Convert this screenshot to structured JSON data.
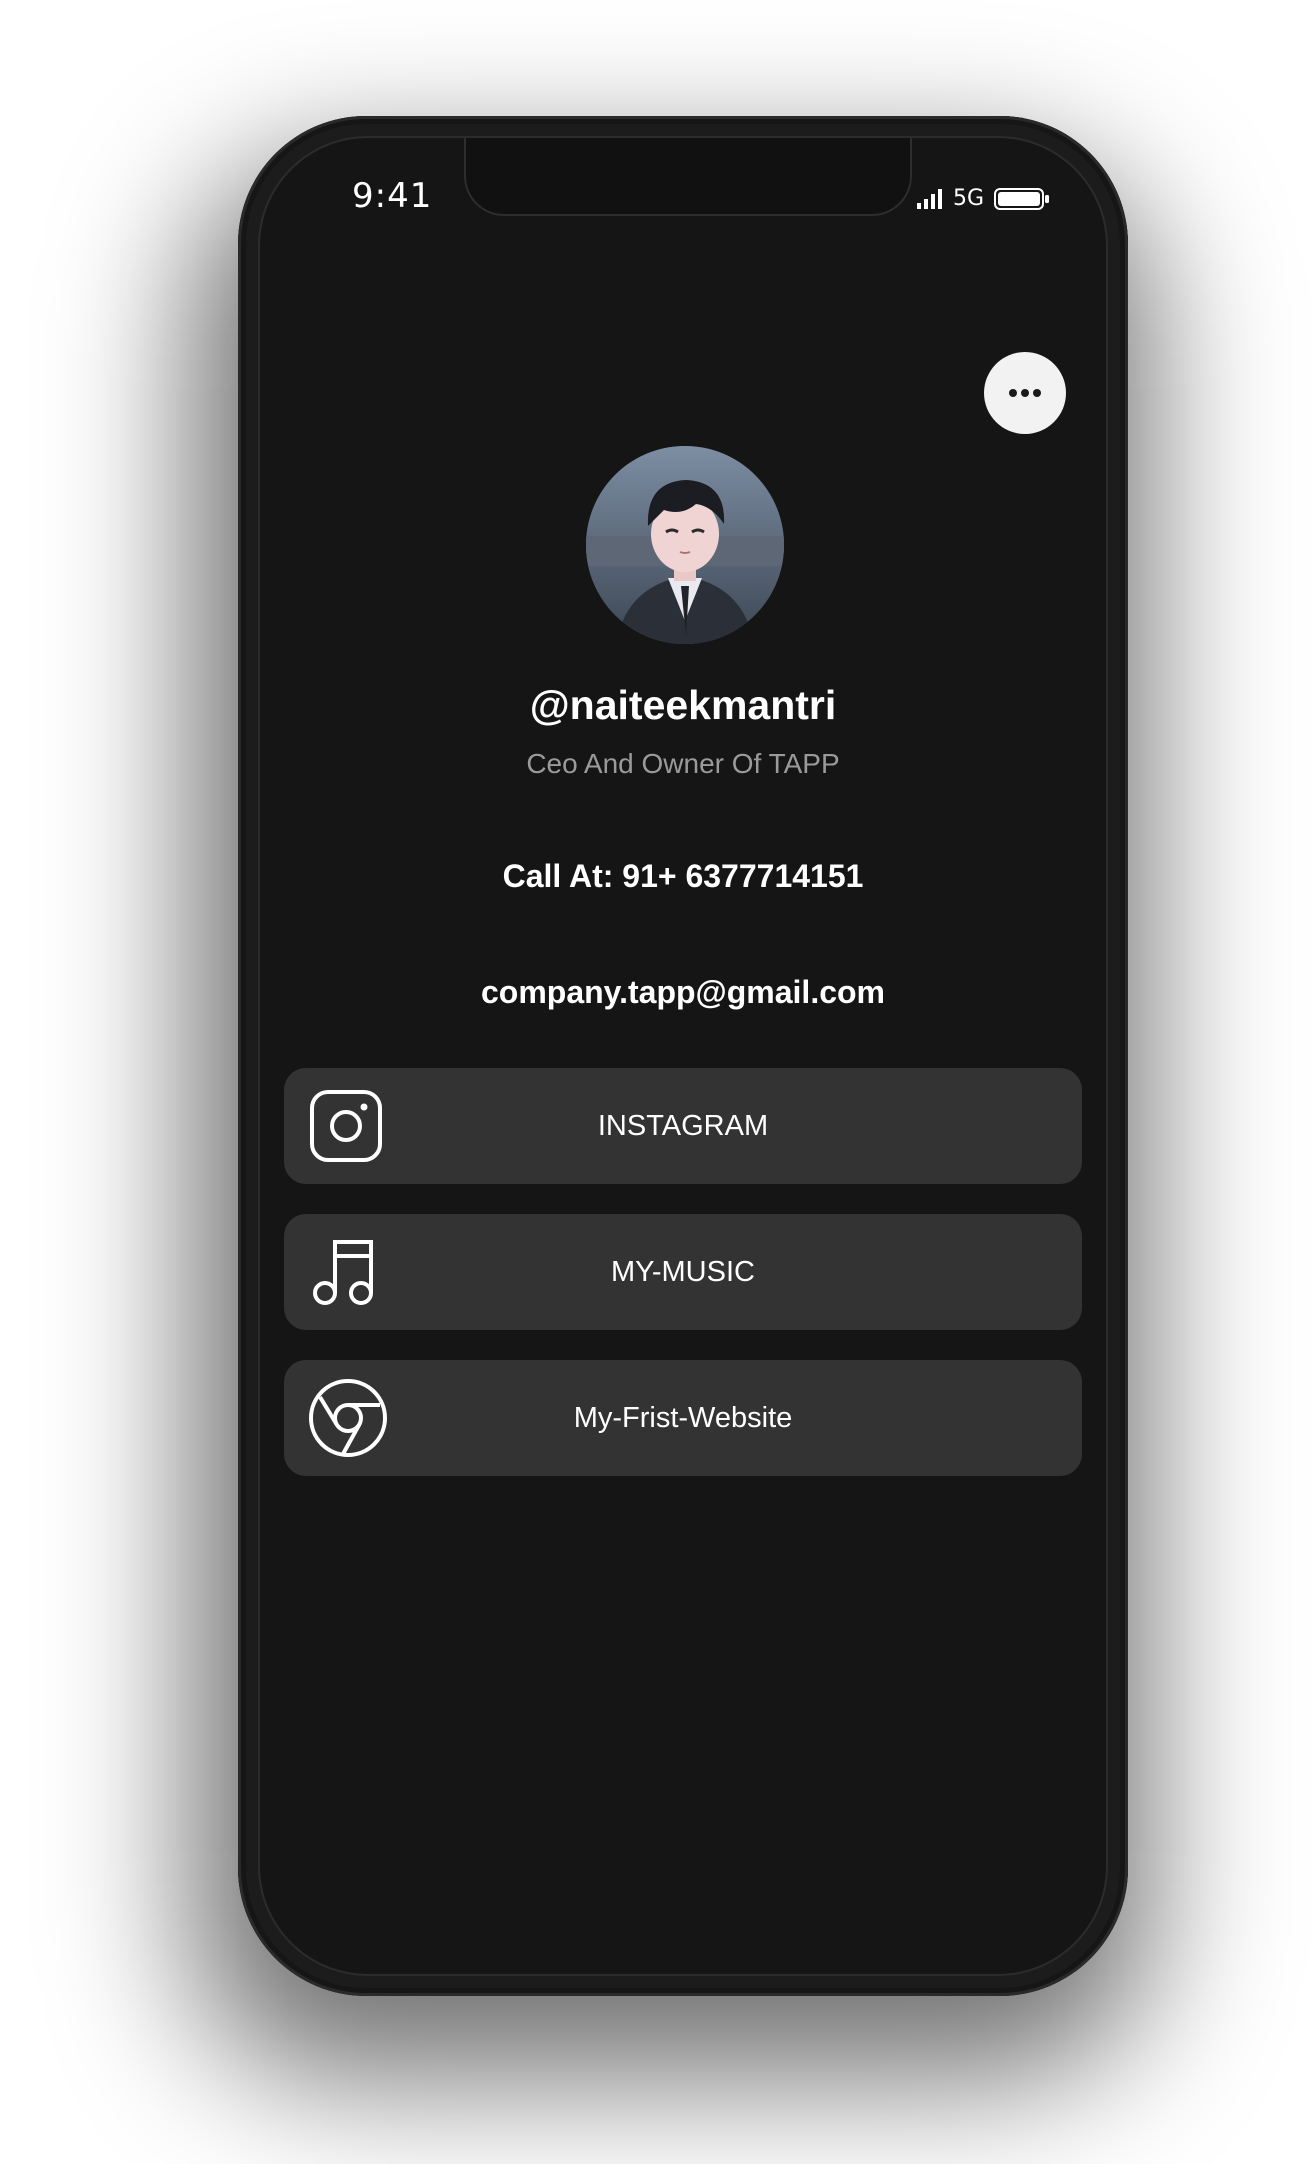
{
  "status_bar": {
    "time": "9:41",
    "network": "5G"
  },
  "icons": {
    "menu": "more-horizontal-icon",
    "signal": "signal-bars-icon",
    "battery": "battery-icon"
  },
  "profile": {
    "username": "@naiteekmantri",
    "bio": "Ceo And Owner Of TAPP",
    "phone": "Call At: 91+ 6377714151",
    "email": "company.tapp@gmail.com"
  },
  "links": [
    {
      "label": "INSTAGRAM",
      "icon": "instagram-icon"
    },
    {
      "label": "MY-MUSIC",
      "icon": "music-note-icon"
    },
    {
      "label": "My-Frist-Website",
      "icon": "chrome-icon"
    }
  ],
  "colors": {
    "screen_bg": "#151515",
    "card_bg": "#333333",
    "text_primary": "#ffffff",
    "text_secondary": "#9a9a9a",
    "menu_button_bg": "#f2f2f2"
  }
}
